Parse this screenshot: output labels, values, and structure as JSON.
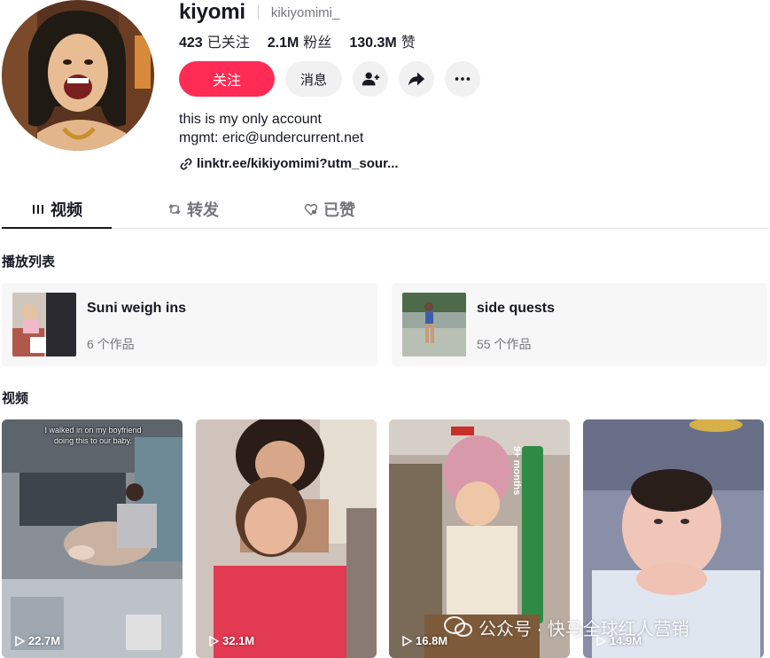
{
  "profile": {
    "display_name": "kiyomi",
    "handle": "kikiyomimi_",
    "stats": [
      {
        "value": "423",
        "label": "已关注"
      },
      {
        "value": "2.1M",
        "label": "粉丝"
      },
      {
        "value": "130.3M",
        "label": "赞"
      }
    ],
    "follow_label": "关注",
    "message_label": "消息",
    "bio_lines": [
      "this is my only account",
      "mgmt: eric@undercurrent.net"
    ],
    "link_text": "linktr.ee/kikiyomimi?utm_sour..."
  },
  "tabs": [
    {
      "label": "视频",
      "icon": "grid-icon",
      "active": true
    },
    {
      "label": "转发",
      "icon": "repost-icon",
      "active": false
    },
    {
      "label": "已赞",
      "icon": "liked-heart-icon",
      "active": false
    }
  ],
  "sections": {
    "playlists_title": "播放列表",
    "videos_title": "视频"
  },
  "playlists": [
    {
      "title": "Suni weigh ins",
      "count": "6 个作品"
    },
    {
      "title": "side quests",
      "count": "55 个作品"
    }
  ],
  "videos": [
    {
      "views": "22.7M",
      "caption": "I walked in on my boyfriend doing this to our baby."
    },
    {
      "views": "32.1M"
    },
    {
      "views": "16.8M",
      "badge": "9+ months"
    },
    {
      "views": "14.9M"
    }
  ],
  "watermark": "公众号 · 快马全球红人营销",
  "colors": {
    "accent": "#fe2c55",
    "text": "#161823",
    "muted": "#75757c",
    "surface": "#f1f1f2"
  }
}
